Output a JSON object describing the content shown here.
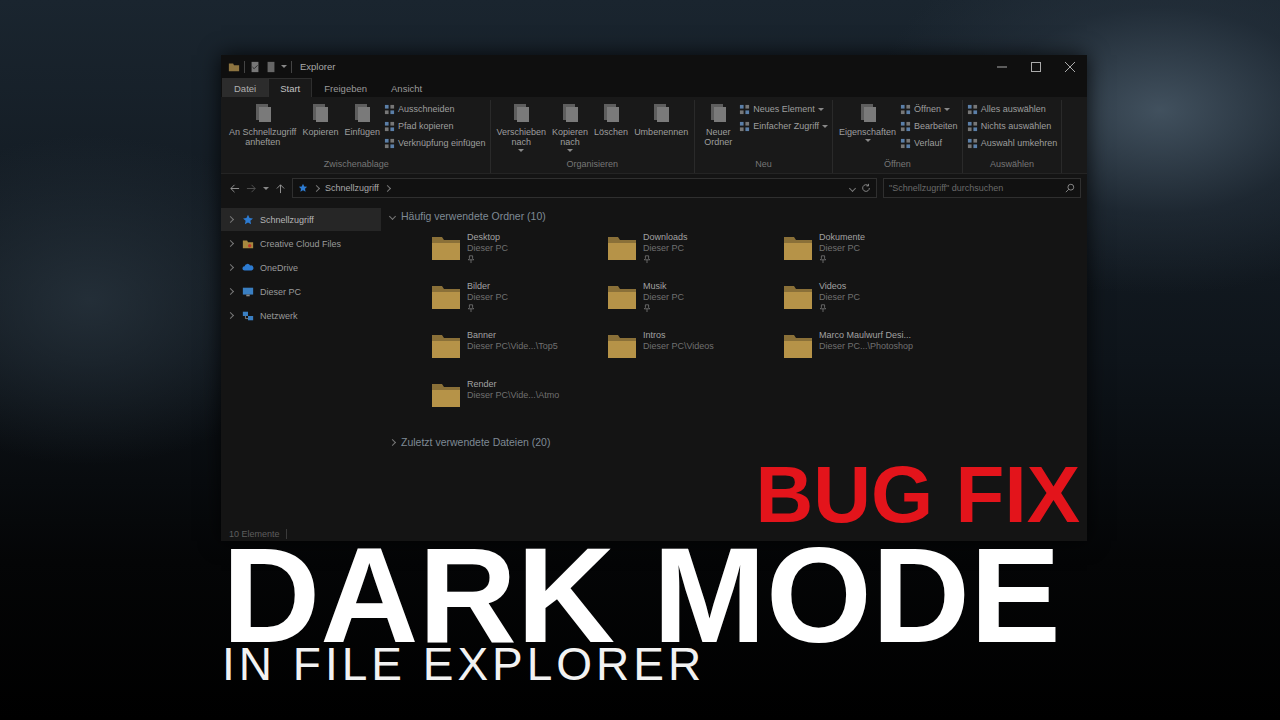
{
  "window": {
    "title": "Explorer",
    "tabs": [
      {
        "label": "Datei",
        "kind": "menu",
        "selected": false
      },
      {
        "label": "Start",
        "kind": "tab",
        "selected": true
      },
      {
        "label": "Freigeben",
        "kind": "tab",
        "selected": false
      },
      {
        "label": "Ansicht",
        "kind": "tab",
        "selected": false
      }
    ]
  },
  "ribbon": {
    "groups": [
      {
        "label": "Zwischenablage",
        "large": [
          {
            "lines": [
              "An Schnellzugriff",
              "anheften"
            ],
            "menu": false
          },
          {
            "lines": [
              "Kopieren"
            ],
            "menu": false
          },
          {
            "lines": [
              "Einfügen"
            ],
            "menu": false
          }
        ],
        "small": [
          {
            "label": "Ausschneiden",
            "menu": false
          },
          {
            "label": "Pfad kopieren",
            "menu": false
          },
          {
            "label": "Verknüpfung einfügen",
            "menu": false
          }
        ]
      },
      {
        "label": "Organisieren",
        "large": [
          {
            "lines": [
              "Verschieben",
              "nach"
            ],
            "menu": true
          },
          {
            "lines": [
              "Kopieren",
              "nach"
            ],
            "menu": true
          },
          {
            "lines": [
              "Löschen"
            ],
            "menu": false
          },
          {
            "lines": [
              "Umbenennen"
            ],
            "menu": false
          }
        ],
        "small": []
      },
      {
        "label": "Neu",
        "large": [
          {
            "lines": [
              "Neuer",
              "Ordner"
            ],
            "menu": false
          }
        ],
        "small": [
          {
            "label": "Neues Element",
            "menu": true
          },
          {
            "label": "Einfacher Zugriff",
            "menu": true
          }
        ]
      },
      {
        "label": "Öffnen",
        "large": [
          {
            "lines": [
              "Eigenschaften"
            ],
            "menu": true
          }
        ],
        "small": [
          {
            "label": "Öffnen",
            "menu": true
          },
          {
            "label": "Bearbeiten",
            "menu": false
          },
          {
            "label": "Verlauf",
            "menu": false
          }
        ]
      },
      {
        "label": "Auswählen",
        "large": [],
        "small": [
          {
            "label": "Alles auswählen",
            "menu": false
          },
          {
            "label": "Nichts auswählen",
            "menu": false
          },
          {
            "label": "Auswahl umkehren",
            "menu": false
          }
        ]
      }
    ]
  },
  "address_bar": {
    "path": [
      "Schnellzugriff"
    ],
    "search": {
      "placeholder": "\"Schnellzugriff\" durchsuchen"
    }
  },
  "sidebar": {
    "items": [
      {
        "label": "Schnellzugriff",
        "selected": true
      },
      {
        "label": "Creative Cloud Files",
        "selected": false
      },
      {
        "label": "OneDrive",
        "selected": false
      },
      {
        "label": "Dieser PC",
        "selected": false
      },
      {
        "label": "Netzwerk",
        "selected": false
      }
    ]
  },
  "sections": [
    {
      "title": "Häufig verwendete Ordner (10)",
      "expanded": true,
      "items": [
        {
          "name": "Desktop",
          "location": "Dieser PC",
          "pinned": true
        },
        {
          "name": "Downloads",
          "location": "Dieser PC",
          "pinned": true
        },
        {
          "name": "Dokumente",
          "location": "Dieser PC",
          "pinned": true
        },
        {
          "name": "Bilder",
          "location": "Dieser PC",
          "pinned": true
        },
        {
          "name": "Musik",
          "location": "Dieser PC",
          "pinned": true
        },
        {
          "name": "Videos",
          "location": "Dieser PC",
          "pinned": true
        },
        {
          "name": "Banner",
          "location": "Dieser PC\\Vide...\\Top5",
          "pinned": false
        },
        {
          "name": "Intros",
          "location": "Dieser PC\\Videos",
          "pinned": false
        },
        {
          "name": "Marco Maulwurf Desi...",
          "location": "Dieser PC...\\Photoshop",
          "pinned": false
        },
        {
          "name": "Render",
          "location": "Dieser PC\\Vide...\\Atmo",
          "pinned": false
        }
      ]
    },
    {
      "title": "Zuletzt verwendete Dateien (20)",
      "expanded": false,
      "items": []
    }
  ],
  "status_bar": {
    "count": "10 Elemente"
  },
  "overlay": {
    "badge": "BUG FIX",
    "headline": "DARK MODE",
    "subline": "IN FILE EXPLORER"
  }
}
